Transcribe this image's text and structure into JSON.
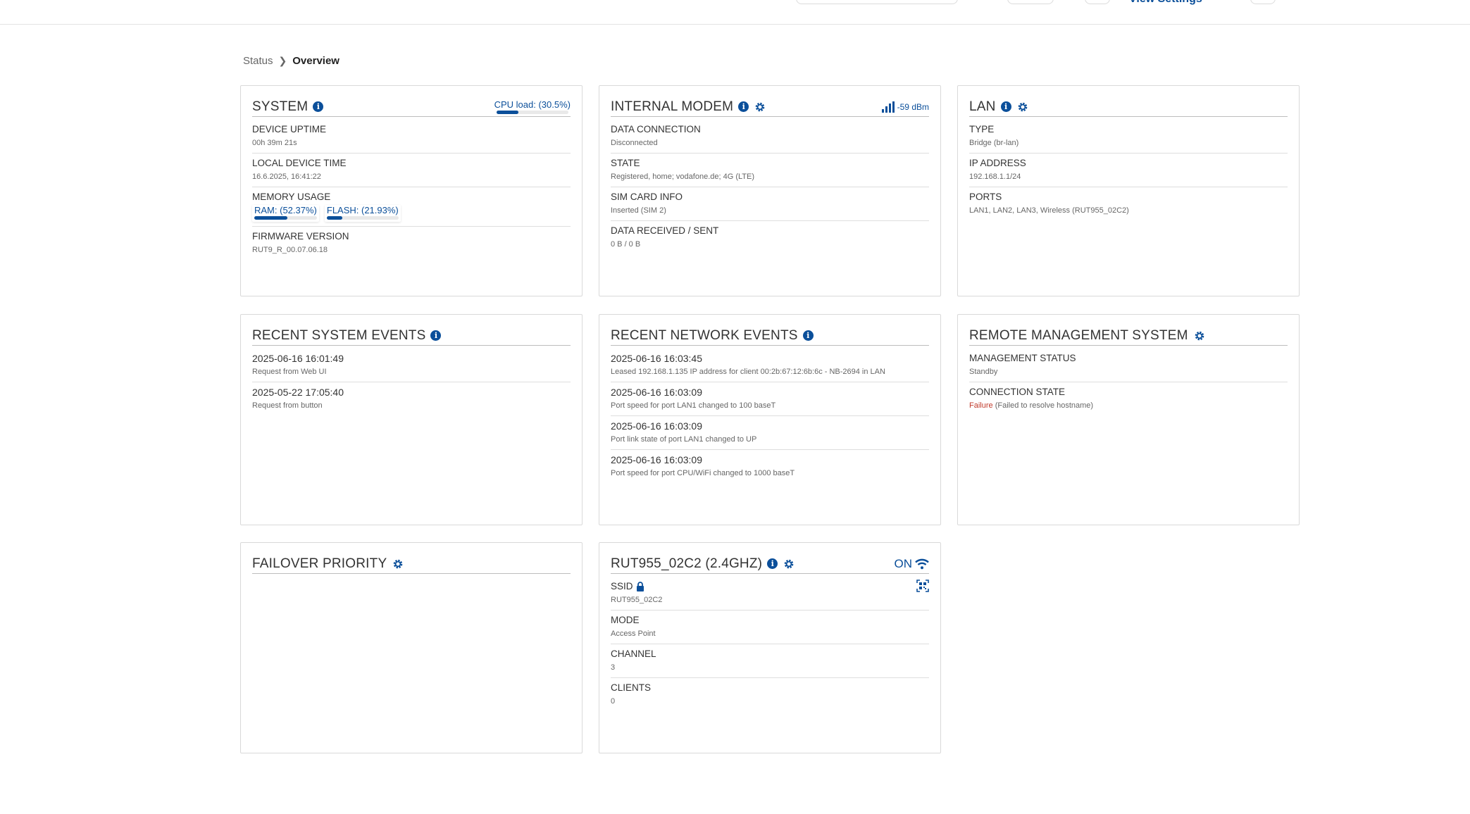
{
  "header": {
    "partial_link_label": "View Settings"
  },
  "breadcrumb": {
    "parent": "Status",
    "current": "Overview"
  },
  "colors": {
    "accent": "#0b4f9a",
    "failure": "#c0392b"
  },
  "system": {
    "title": "SYSTEM",
    "cpu_label": "CPU load: (30.5%)",
    "cpu_load_fraction": 0.305,
    "rows": [
      {
        "label": "DEVICE UPTIME",
        "value": "00h 39m 21s"
      },
      {
        "label": "LOCAL DEVICE TIME",
        "value": "16.6.2025, 16:41:22"
      },
      {
        "label": "MEMORY USAGE",
        "ram_label": "RAM: (52.37%)",
        "ram_fraction": 0.5237,
        "flash_label": "FLASH: (21.93%)",
        "flash_fraction": 0.2193
      },
      {
        "label": "FIRMWARE VERSION",
        "value": "RUT9_R_00.07.06.18"
      }
    ]
  },
  "modem": {
    "title": "INTERNAL MODEM",
    "signal": "-59 dBm",
    "rows": [
      {
        "label": "DATA CONNECTION",
        "value": "Disconnected"
      },
      {
        "label": "STATE",
        "value": "Registered, home; vodafone.de; 4G (LTE)"
      },
      {
        "label": "SIM CARD INFO",
        "value": "Inserted (SIM 2)"
      },
      {
        "label": "DATA RECEIVED / SENT",
        "value": "0 B / 0 B"
      }
    ]
  },
  "lan": {
    "title": "LAN",
    "rows": [
      {
        "label": "TYPE",
        "value": "Bridge (br-lan)"
      },
      {
        "label": "IP ADDRESS",
        "value": "192.168.1.1/24"
      },
      {
        "label": "PORTS",
        "value": "LAN1, LAN2, LAN3, Wireless (RUT955_02C2)"
      }
    ]
  },
  "system_events": {
    "title": "RECENT SYSTEM EVENTS",
    "items": [
      {
        "time": "2025-06-16 16:01:49",
        "text": "Request from Web UI"
      },
      {
        "time": "2025-05-22 17:05:40",
        "text": "Request from button"
      }
    ]
  },
  "network_events": {
    "title": "RECENT NETWORK EVENTS",
    "items": [
      {
        "time": "2025-06-16 16:03:45",
        "text": "Leased 192.168.1.135 IP address for client 00:2b:67:12:6b:6c - NB-2694 in LAN"
      },
      {
        "time": "2025-06-16 16:03:09",
        "text": "Port speed for port LAN1 changed to 100 baseT"
      },
      {
        "time": "2025-06-16 16:03:09",
        "text": "Port link state of port LAN1 changed to UP"
      },
      {
        "time": "2025-06-16 16:03:09",
        "text": "Port speed for port CPU/WiFi changed to 1000 baseT"
      }
    ]
  },
  "rms": {
    "title": "REMOTE MANAGEMENT SYSTEM",
    "rows": [
      {
        "label": "MANAGEMENT STATUS",
        "value": "Standby"
      },
      {
        "label": "CONNECTION STATE",
        "value_status": "Failure",
        "value_detail": "(Failed to resolve hostname)"
      }
    ]
  },
  "failover": {
    "title": "FAILOVER PRIORITY"
  },
  "wifi": {
    "title": "RUT955_02C2 (2.4GHZ)",
    "state": "ON",
    "rows": [
      {
        "label": "SSID",
        "value": "RUT955_02C2"
      },
      {
        "label": "MODE",
        "value": "Access Point"
      },
      {
        "label": "CHANNEL",
        "value": "3"
      },
      {
        "label": "CLIENTS",
        "value": "0"
      }
    ]
  }
}
